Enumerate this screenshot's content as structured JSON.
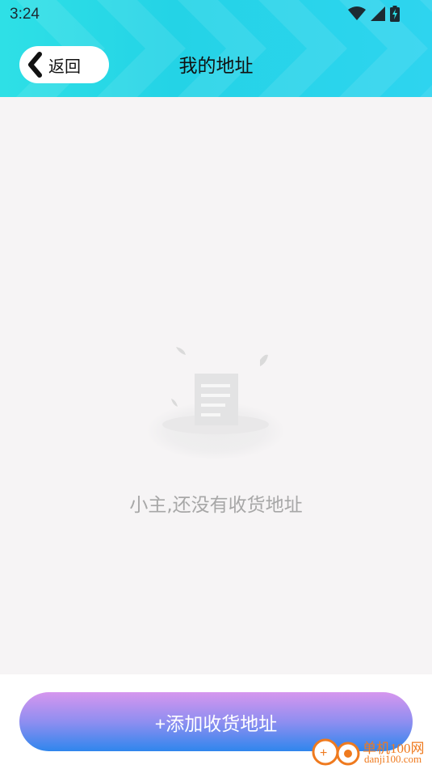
{
  "status_bar": {
    "time": "3:24",
    "icons": [
      "wifi-icon",
      "signal-icon",
      "battery-charging-icon"
    ]
  },
  "header": {
    "back_label": "返回",
    "title": "我的地址",
    "back_icon": "chevron-left-icon"
  },
  "empty_state": {
    "icon": "empty-document-icon",
    "message": "小主,还没有收货地址"
  },
  "footer": {
    "add_button_label": "+添加收货地址"
  },
  "watermark": {
    "name": "单机100网",
    "url": "danji100.com"
  },
  "colors": {
    "header_start": "#2ee0e6",
    "header_end": "#2ed4ef",
    "button_top": "#d696ee",
    "button_bottom": "#2f86ed",
    "background": "#f6f4f5",
    "empty_text": "#a7a7a7",
    "watermark": "#ef7a1e"
  }
}
